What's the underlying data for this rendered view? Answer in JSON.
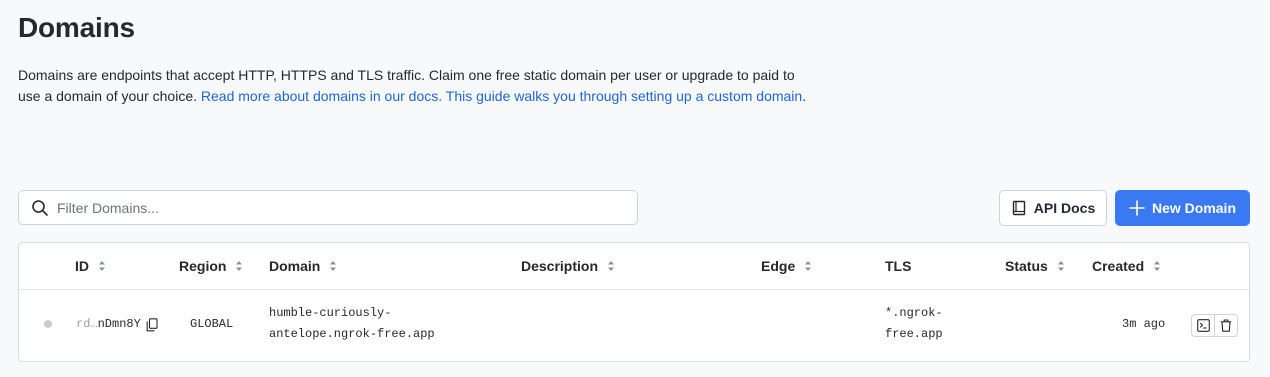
{
  "page": {
    "title": "Domains",
    "description_prefix": "Domains are endpoints that accept HTTP, HTTPS and TLS traffic. Claim one free static domain per user or upgrade to paid to use a domain of your choice. ",
    "docs_link": "Read more about domains in our docs.",
    "guide_link": " This guide walks you through setting up a custom domain",
    "description_suffix": "."
  },
  "toolbar": {
    "filter_placeholder": "Filter Domains...",
    "api_docs_label": "API Docs",
    "new_domain_label": "New Domain"
  },
  "table": {
    "columns": [
      "ID",
      "Region",
      "Domain",
      "Description",
      "Edge",
      "TLS",
      "Status",
      "Created"
    ],
    "rows": [
      {
        "id_prefix": "rd…",
        "id_suffix": "nDmn8Y",
        "region": "GLOBAL",
        "domain_line1": "humble-curiously-",
        "domain_line2": "antelope.ngrok-free.app",
        "description": "",
        "edge": "",
        "tls_line1": "*.ngrok-",
        "tls_line2": "free.app",
        "status": "",
        "created": "3m ago"
      }
    ]
  },
  "colors": {
    "primary": "#3a79f2",
    "link": "#1e66d6",
    "background": "#f8f9fb"
  }
}
